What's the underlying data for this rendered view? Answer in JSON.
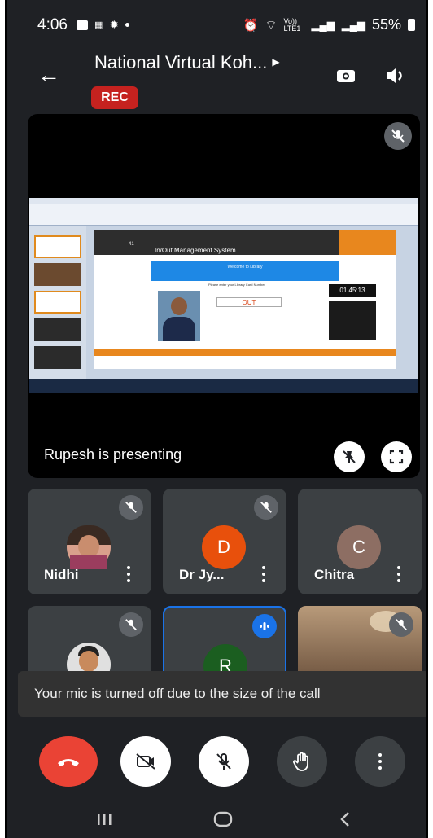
{
  "status_bar": {
    "time": "4:06",
    "battery": "55%",
    "left_icons": [
      "image-icon",
      "dots-icon",
      "sun-icon",
      "dot-icon"
    ],
    "right_icons": [
      "alarm-icon",
      "wifi-icon",
      "volte-icon",
      "signal-icon",
      "signal-icon",
      "battery-icon"
    ],
    "volte_text": "Vo)) LTE1"
  },
  "header": {
    "title": "National Virtual Koh...",
    "rec_label": "REC",
    "icons": [
      "back-arrow-icon",
      "switch-camera-icon",
      "speaker-icon"
    ]
  },
  "presentation": {
    "presenting_label": "Rupesh is presenting",
    "slide": {
      "app_title_text": "In/Out Management System",
      "welcome_text": "Welcome to Library",
      "prompt_text": "Please enter your Library Card Number",
      "status_text": "OUT",
      "clock_text": "01:45:13",
      "slide_number": "41"
    }
  },
  "tiles": [
    {
      "name": "Nidhi",
      "initial": "",
      "type": "photo"
    },
    {
      "name": "Dr Jy...",
      "initial": "D",
      "type": "initial",
      "color": "#e8500c"
    },
    {
      "name": "Chitra",
      "initial": "C",
      "type": "initial",
      "color": "#8d6e63"
    },
    {
      "name": "",
      "initial": "",
      "type": "photo"
    },
    {
      "name": "",
      "initial": "R",
      "type": "initial",
      "color": "#1b5e20",
      "speaking": true
    },
    {
      "name": "",
      "initial": "",
      "type": "video"
    }
  ],
  "toast": {
    "text": "Your mic is turned off due to the size of the call"
  },
  "controls": {
    "colors": {
      "end_call": "#ea4335",
      "white": "#ffffff",
      "dark": "#3c4043"
    },
    "icons": [
      "end-call-icon",
      "camera-off-icon",
      "mic-off-icon",
      "raise-hand-icon",
      "more-options-icon"
    ]
  },
  "nav": {
    "icons": [
      "recents-icon",
      "home-icon",
      "back-icon"
    ]
  }
}
